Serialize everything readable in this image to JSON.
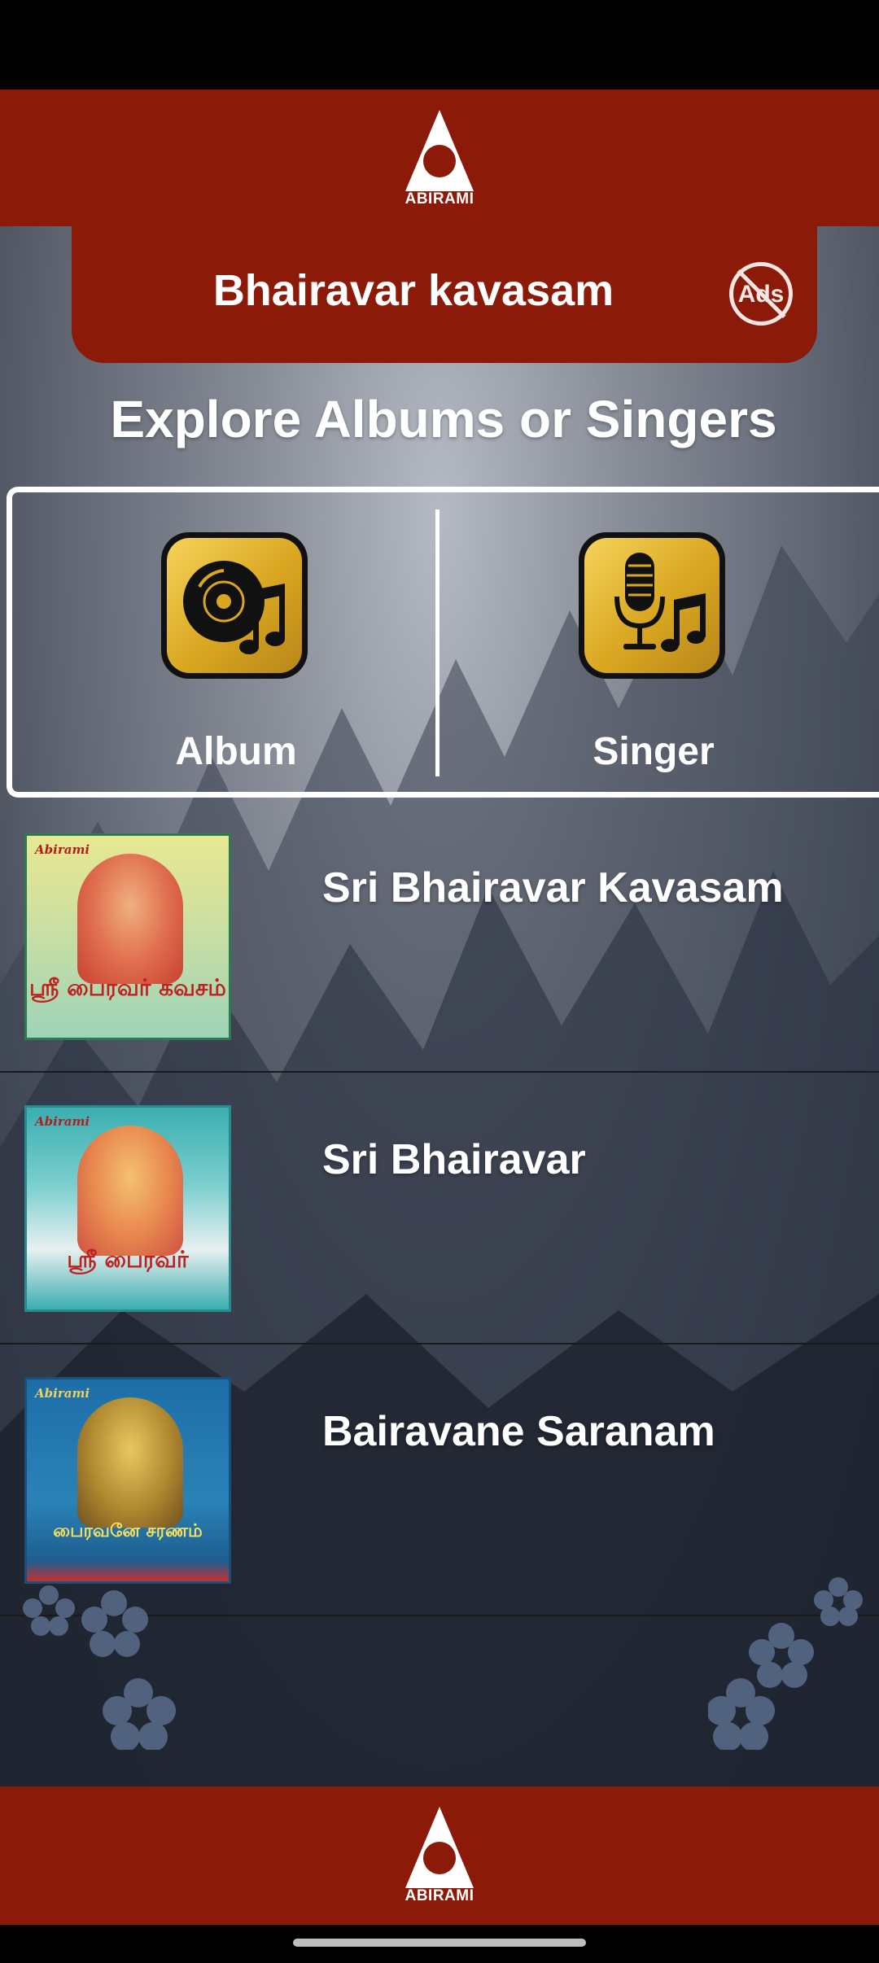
{
  "header": {
    "brand_name": "ABIRAMI",
    "page_title": "Bhairavar kavasam",
    "ads_button_label": "Ads",
    "ads_icon": "no-ads-icon"
  },
  "explore": {
    "heading": "Explore Albums or Singers",
    "options": [
      {
        "label": "Album",
        "icon": "album-music-icon"
      },
      {
        "label": "Singer",
        "icon": "microphone-music-icon"
      }
    ]
  },
  "albums": [
    {
      "title": "Sri Bhairavar Kavasam",
      "cover_brand": "Abirami",
      "cover_text": "ஸ்ரீ பைரவர் கவசம்"
    },
    {
      "title": "Sri Bhairavar",
      "cover_brand": "Abirami",
      "cover_text": "ஸ்ரீ பைரவர்"
    },
    {
      "title": "Bairavane Saranam",
      "cover_brand": "Abirami",
      "cover_text": "பைரவனே சரணம்"
    }
  ],
  "footer": {
    "brand_name": "ABIRAMI"
  },
  "colors": {
    "brand_red": "#8b1a08",
    "gold": "#d9a620"
  }
}
